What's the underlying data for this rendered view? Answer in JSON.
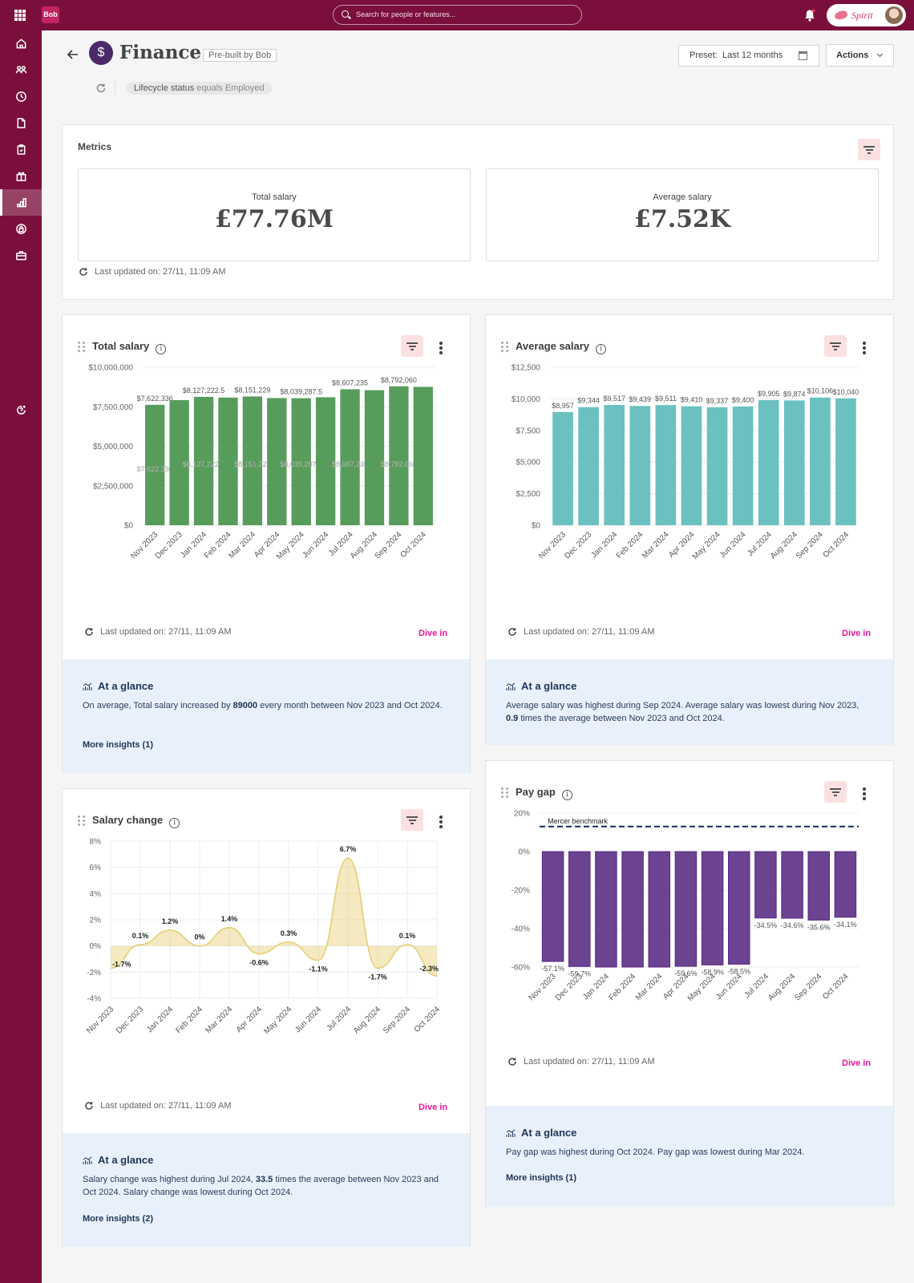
{
  "topbar": {
    "logo": "Bob",
    "search_placeholder": "Search for people or features...",
    "spirit_label": "Spirit",
    "icons": [
      "apps-grid-icon",
      "bell-icon",
      "user-avatar"
    ]
  },
  "sidebar": {
    "items": [
      {
        "name": "home",
        "icon": "home-icon"
      },
      {
        "name": "people",
        "icon": "people-icon"
      },
      {
        "name": "time",
        "icon": "clock-icon"
      },
      {
        "name": "documents",
        "icon": "document-icon"
      },
      {
        "name": "tasks",
        "icon": "clipboard-icon"
      },
      {
        "name": "benefits",
        "icon": "gift-icon"
      },
      {
        "name": "analytics",
        "icon": "bar-chart-icon",
        "active": true
      },
      {
        "name": "privacy",
        "icon": "lock-icon"
      },
      {
        "name": "jobs",
        "icon": "briefcase-icon"
      }
    ],
    "help_icon": "help-sparkle-icon"
  },
  "header": {
    "title": "Finance",
    "badge": "Pre-built by Bob",
    "icon_glyph": "$",
    "filter": {
      "field": "Lifecycle status",
      "op": "equals",
      "value": "Employed"
    },
    "preset_label": "Preset:",
    "preset_value": "Last 12 months",
    "actions_label": "Actions"
  },
  "metrics": {
    "title": "Metrics",
    "cards": [
      {
        "label": "Total salary",
        "value": "£77.76M"
      },
      {
        "label": "Average salary",
        "value": "£7.52K"
      }
    ],
    "last_updated": "Last updated on: 27/11, 11:09 AM"
  },
  "common": {
    "last_updated": "Last updated on: 27/11, 11:09 AM",
    "dive_in": "Dive in",
    "glance_title": "At a glance"
  },
  "widgets": {
    "total_salary": {
      "title": "Total salary",
      "glance_pre": "On average, Total salary increased by ",
      "glance_bold": "89000",
      "glance_post": " every month between Nov 2023 and Oct 2024.",
      "more": "More insights (1)"
    },
    "average_salary": {
      "title": "Average salary",
      "glance_pre": "Average salary was highest during Sep 2024. Average salary was lowest during Nov 2023, ",
      "glance_bold": "0.9",
      "glance_post": " times the average between Nov 2023 and Oct 2024."
    },
    "salary_change": {
      "title": "Salary change",
      "glance_pre": "Salary change was highest during Jul 2024, ",
      "glance_bold": "33.5",
      "glance_post": " times the average between Nov 2023 and Oct 2024. Salary change was lowest during Oct 2024.",
      "more": "More insights (2)"
    },
    "pay_gap": {
      "title": "Pay gap",
      "glance_text": "Pay gap was highest during Oct 2024. Pay gap was lowest during Mar 2024.",
      "more": "More insights (1)"
    }
  },
  "chart_data": [
    {
      "id": "total_salary",
      "type": "bar",
      "title": "Total salary",
      "categories": [
        "Nov 2023",
        "Dec 2023",
        "Jan 2024",
        "Feb 2024",
        "Mar 2024",
        "Apr 2024",
        "May 2024",
        "Jun 2024",
        "Jul 2024",
        "Aug 2024",
        "Sep 2024",
        "Oct 2024"
      ],
      "values": [
        7622336,
        7920000,
        8127222.5,
        8080000,
        8151229,
        8050000,
        8039287.5,
        8100000,
        8607235,
        8550000,
        8792060,
        8760000
      ],
      "data_labels": [
        "$7,622,336",
        "",
        "$8,127,222.5",
        "",
        "$8,151,229",
        "",
        "$8,039,287.5",
        "",
        "$8,607,235",
        "",
        "$8,792,060",
        ""
      ],
      "yticks": [
        "$0",
        "$2,500,000",
        "$5,000,000",
        "$7,500,000",
        "$10,000,000"
      ],
      "ylim": [
        0,
        10000000
      ],
      "color": "#579c5b",
      "grid": true
    },
    {
      "id": "average_salary",
      "type": "bar",
      "title": "Average salary",
      "categories": [
        "Nov 2023",
        "Dec 2023",
        "Jan 2024",
        "Feb 2024",
        "Mar 2024",
        "Apr 2024",
        "May 2024",
        "Jun 2024",
        "Jul 2024",
        "Aug 2024",
        "Sep 2024",
        "Oct 2024"
      ],
      "values": [
        8957,
        9344,
        9517,
        9439,
        9511,
        9410,
        9337,
        9400,
        9905,
        9874,
        10106,
        10040
      ],
      "data_labels": [
        "$8,957",
        "$9,344",
        "$9,517",
        "$9,439",
        "$9,511",
        "$9,410",
        "$9,337",
        "$9,400",
        "$9,905",
        "$9,874",
        "$10,106",
        "$10,040"
      ],
      "yticks": [
        "$0",
        "$2,500",
        "$5,000",
        "$7,500",
        "$10,000",
        "$12,500"
      ],
      "ylim": [
        0,
        12500
      ],
      "color": "#6bc1c0",
      "grid": true
    },
    {
      "id": "salary_change",
      "type": "area",
      "title": "Salary change",
      "categories": [
        "Nov 2023",
        "Dec 2023",
        "Jan 2024",
        "Feb 2024",
        "Mar 2024",
        "Apr 2024",
        "May 2024",
        "Jun 2024",
        "Jul 2024",
        "Aug 2024",
        "Sep 2024",
        "Oct 2024"
      ],
      "values": [
        -1.7,
        0.1,
        1.2,
        0,
        1.4,
        -0.6,
        0.3,
        -1.1,
        6.7,
        -1.7,
        0.1,
        -2.3
      ],
      "data_labels": [
        "-1.7%",
        "0.1%",
        "1.2%",
        "0%",
        "1.4%",
        "-0.6%",
        "0.3%",
        "-1.1%",
        "6.7%",
        "-1.7%",
        "0.1%",
        "-2.3%"
      ],
      "yticks": [
        "-4%",
        "-2%",
        "0%",
        "2%",
        "4%",
        "6%",
        "8%"
      ],
      "ylim": [
        -4,
        8
      ],
      "color": "#e6cf74",
      "grid": true
    },
    {
      "id": "pay_gap",
      "type": "bar",
      "title": "Pay gap",
      "categories": [
        "Nov 2023",
        "Dec 2023",
        "Jan 2024",
        "Feb 2024",
        "Mar 2024",
        "Apr 2024",
        "May 2024",
        "Jun 2024",
        "Jul 2024",
        "Aug 2024",
        "Sep 2024",
        "Oct 2024"
      ],
      "values": [
        -57.1,
        -59.7,
        -60,
        -60,
        -60,
        -59.6,
        -58.9,
        -58.5,
        -34.5,
        -34.6,
        -35.6,
        -34.1
      ],
      "data_labels": [
        "-57.1%",
        "-59.7%",
        "",
        "",
        "",
        "-59.6%",
        "-58.9%",
        "-58.5%",
        "-34.5%",
        "-34.6%",
        "-35.6%",
        "-34.1%"
      ],
      "yticks": [
        "-60%",
        "-40%",
        "-20%",
        "0%",
        "20%"
      ],
      "ylim": [
        -60,
        20
      ],
      "color": "#6b4391",
      "benchmark": {
        "label": "Mercer benchmark",
        "value": 13
      },
      "grid": true
    }
  ]
}
